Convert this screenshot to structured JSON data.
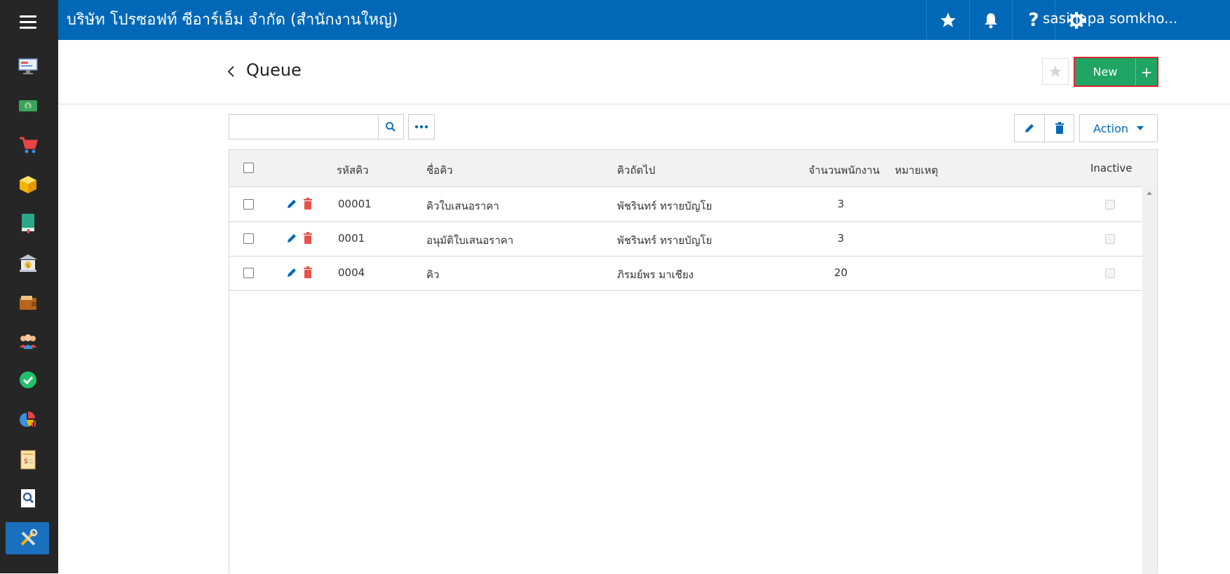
{
  "topbar": {
    "company": "บริษัท โปรซอฟท์ ซีอาร์เอ็ม จำกัด (สำนักงานใหญ่)",
    "user": "sasinapa somkho...",
    "icons": [
      "star-icon",
      "bell-icon",
      "help-icon",
      "gear-icon"
    ]
  },
  "sidebar": {
    "icons": [
      "monitor-icon",
      "money-icon",
      "cart-icon",
      "box-icon",
      "book-icon",
      "bank-icon",
      "wallet-icon",
      "team-icon",
      "check-icon",
      "chart-icon",
      "invoice-icon",
      "search-doc-icon",
      "tools-icon"
    ],
    "active": "tools-icon"
  },
  "page": {
    "title": "Queue",
    "new_label": "New",
    "new_plus": "+",
    "action_label": "Action"
  },
  "search": {
    "value": "",
    "placeholder": ""
  },
  "table": {
    "columns": [
      "รหัสคิว",
      "ชื่อคิว",
      "คิวถัดไป",
      "จำนวนพนักงาน",
      "หมายเหตุ",
      "Inactive"
    ],
    "rows": [
      {
        "code": "00001",
        "name": "คิวใบเสนอราคา",
        "next": "พัชรินทร์ ทรายบัญโย",
        "staff": "3",
        "note": "",
        "inactive": false
      },
      {
        "code": "0001",
        "name": "อนุมัติใบเสนอราคา",
        "next": "พัชรินทร์ ทรายบัญโย",
        "staff": "3",
        "note": "",
        "inactive": false
      },
      {
        "code": "0004",
        "name": "คิว",
        "next": "ภิรมย์พร มาเชียง",
        "staff": "20",
        "note": "",
        "inactive": false
      }
    ]
  },
  "colors": {
    "topbar": "#0068b6",
    "sidebar": "#262626",
    "new_button": "#1fa463",
    "highlight": "#e0242c",
    "delete_icon": "#e8524a"
  }
}
